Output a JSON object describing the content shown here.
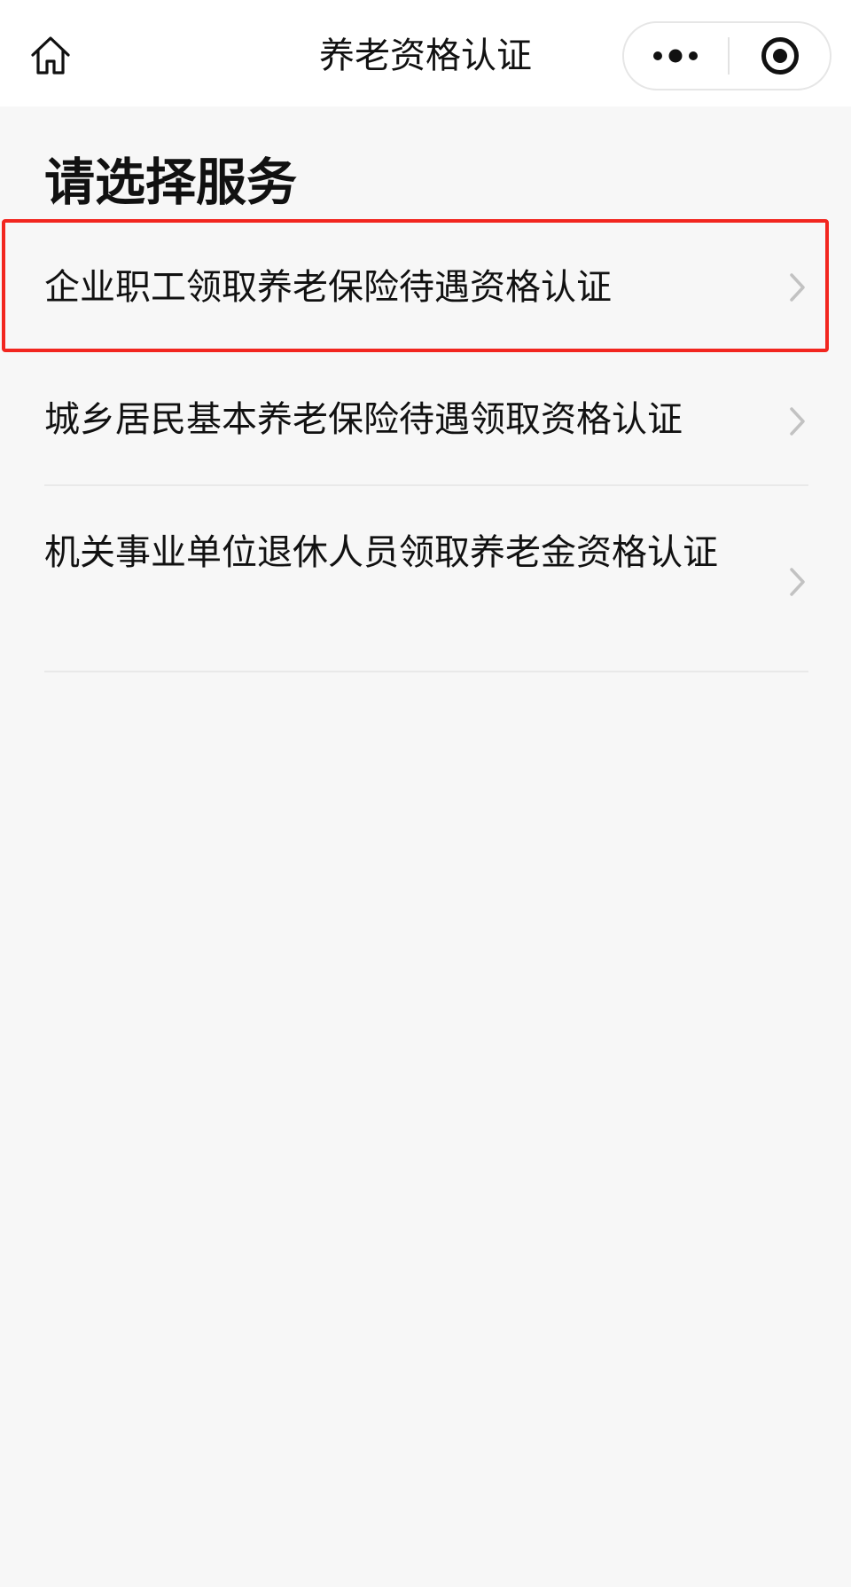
{
  "nav": {
    "title": "养老资格认证",
    "icons": {
      "home": "home-icon",
      "more": "more-dots-icon",
      "close": "close-target-icon"
    }
  },
  "heading": "请选择服务",
  "services": [
    {
      "label": "企业职工领取养老保险待遇资格认证"
    },
    {
      "label": "城乡居民基本养老保险待遇领取资格认证"
    },
    {
      "label": "机关事业单位退休人员领取养老金资格认证"
    }
  ],
  "colors": {
    "highlight_border": "#f2261f",
    "background": "#f7f7f7",
    "chevron": "#c2c2c2"
  }
}
